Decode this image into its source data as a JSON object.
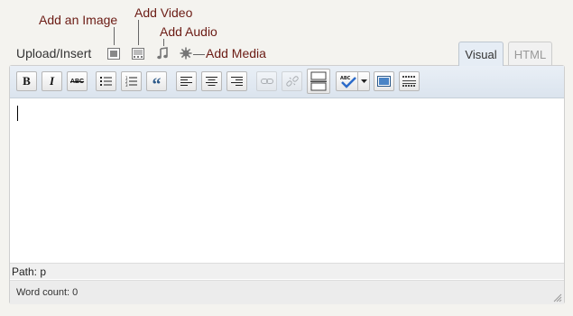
{
  "annotations": {
    "add_image": "Add an Image",
    "add_video": "Add Video",
    "add_audio": "Add Audio",
    "add_media": "Add Media"
  },
  "upload_insert_label": "Upload/Insert",
  "tabs": {
    "visual": "Visual",
    "html": "HTML",
    "active": "visual"
  },
  "toolbar": {
    "buttons": [
      {
        "name": "bold",
        "label": "B"
      },
      {
        "name": "italic",
        "label": "I"
      },
      {
        "name": "strikethrough",
        "label": "ABC"
      },
      {
        "name": "bullet-list"
      },
      {
        "name": "numbered-list"
      },
      {
        "name": "blockquote",
        "label": "“"
      },
      {
        "name": "align-left"
      },
      {
        "name": "align-center"
      },
      {
        "name": "align-right"
      },
      {
        "name": "insert-link",
        "disabled": true
      },
      {
        "name": "unlink",
        "disabled": true
      },
      {
        "name": "insert-more"
      },
      {
        "name": "spellcheck",
        "label": "ABC"
      },
      {
        "name": "fullscreen"
      },
      {
        "name": "kitchen-sink"
      }
    ]
  },
  "status": {
    "path_label": "Path: p",
    "word_count_label": "Word count: 0"
  },
  "colors": {
    "annotation": "#6b1b14",
    "toolbar_bg": "#dbe4ee",
    "active_tab_bg": "#e6edf5"
  }
}
